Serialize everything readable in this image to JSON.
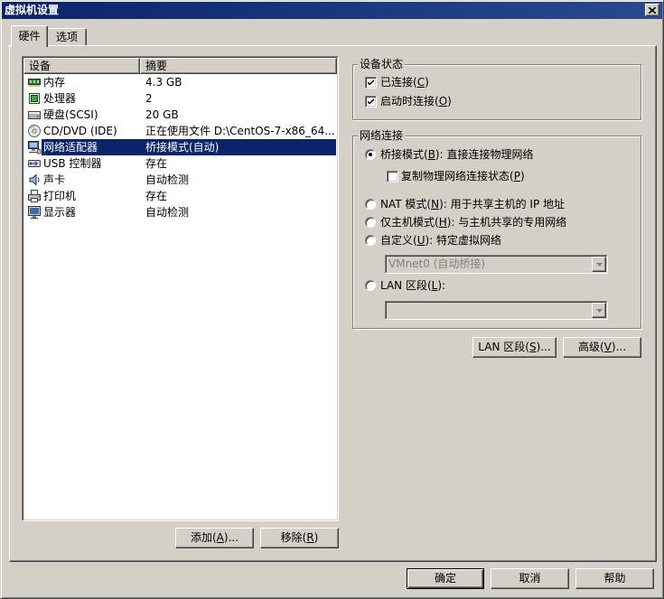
{
  "window": {
    "title": "虚拟机设置"
  },
  "tabs": [
    {
      "label": "硬件",
      "selected": true
    },
    {
      "label": "选项",
      "selected": false
    }
  ],
  "device_list": {
    "columns": {
      "device": "设备",
      "summary": "摘要"
    },
    "rows": [
      {
        "icon": "memory-icon",
        "device": "内存",
        "summary": "4.3 GB",
        "selected": false
      },
      {
        "icon": "processor-icon",
        "device": "处理器",
        "summary": "2",
        "selected": false
      },
      {
        "icon": "hard-disk-icon",
        "device": "硬盘(SCSI)",
        "summary": "20 GB",
        "selected": false
      },
      {
        "icon": "cd-dvd-icon",
        "device": "CD/DVD (IDE)",
        "summary": "正在使用文件 D:\\CentOS-7-x86_64...",
        "selected": false
      },
      {
        "icon": "network-adapter-icon",
        "device": "网络适配器",
        "summary": "桥接模式(自动)",
        "selected": true
      },
      {
        "icon": "usb-icon",
        "device": "USB 控制器",
        "summary": "存在",
        "selected": false
      },
      {
        "icon": "sound-card-icon",
        "device": "声卡",
        "summary": "自动检测",
        "selected": false
      },
      {
        "icon": "printer-icon",
        "device": "打印机",
        "summary": "存在",
        "selected": false
      },
      {
        "icon": "display-icon",
        "device": "显示器",
        "summary": "自动检测",
        "selected": false
      }
    ],
    "add_button": "添加(A)...",
    "remove_button": "移除(R)"
  },
  "device_status": {
    "title": "设备状态",
    "connected": {
      "label": "已连接(C)",
      "checked": true
    },
    "connect_at_power_on": {
      "label": "启动时连接(O)",
      "checked": true
    }
  },
  "network_connection": {
    "title": "网络连接",
    "bridged": {
      "label": "桥接模式(B): 直接连接物理网络",
      "selected": true
    },
    "replicate_state": {
      "label": "复制物理网络连接状态(P)",
      "checked": false
    },
    "nat": {
      "label": "NAT 模式(N): 用于共享主机的 IP 地址",
      "selected": false
    },
    "host_only": {
      "label": "仅主机模式(H): 与主机共享的专用网络",
      "selected": false
    },
    "custom": {
      "label": "自定义(U): 特定虚拟网络",
      "selected": false
    },
    "custom_network_select": {
      "value": "VMnet0 (自动桥接)",
      "enabled": false
    },
    "lan_segment": {
      "label": "LAN 区段(L):",
      "selected": false
    },
    "lan_segment_select": {
      "value": "",
      "enabled": false
    }
  },
  "panel_buttons": {
    "lan_segments": "LAN 区段(S)...",
    "advanced": "高级(V)..."
  },
  "footer": {
    "ok": "确定",
    "cancel": "取消",
    "help": "帮助"
  },
  "colors": {
    "face": "#d4d0c8",
    "selection": "#0a246a",
    "title_bar": "#0a246a",
    "disabled_text": "#808080"
  }
}
